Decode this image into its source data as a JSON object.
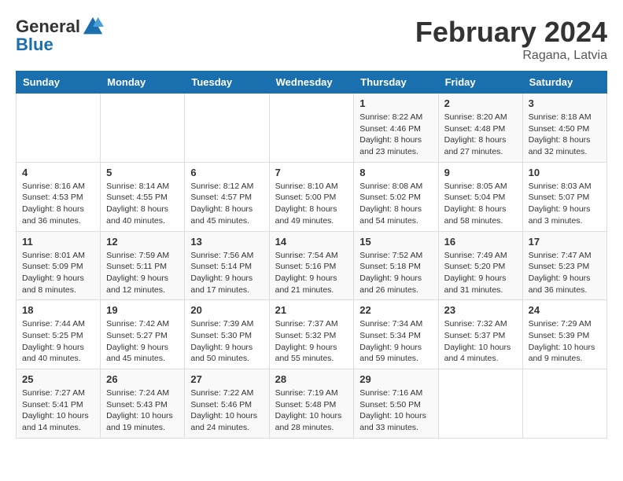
{
  "header": {
    "logo_general": "General",
    "logo_blue": "Blue",
    "month_year": "February 2024",
    "location": "Ragana, Latvia"
  },
  "weekdays": [
    "Sunday",
    "Monday",
    "Tuesday",
    "Wednesday",
    "Thursday",
    "Friday",
    "Saturday"
  ],
  "weeks": [
    [
      {
        "day": "",
        "info": ""
      },
      {
        "day": "",
        "info": ""
      },
      {
        "day": "",
        "info": ""
      },
      {
        "day": "",
        "info": ""
      },
      {
        "day": "1",
        "info": "Sunrise: 8:22 AM\nSunset: 4:46 PM\nDaylight: 8 hours\nand 23 minutes."
      },
      {
        "day": "2",
        "info": "Sunrise: 8:20 AM\nSunset: 4:48 PM\nDaylight: 8 hours\nand 27 minutes."
      },
      {
        "day": "3",
        "info": "Sunrise: 8:18 AM\nSunset: 4:50 PM\nDaylight: 8 hours\nand 32 minutes."
      }
    ],
    [
      {
        "day": "4",
        "info": "Sunrise: 8:16 AM\nSunset: 4:53 PM\nDaylight: 8 hours\nand 36 minutes."
      },
      {
        "day": "5",
        "info": "Sunrise: 8:14 AM\nSunset: 4:55 PM\nDaylight: 8 hours\nand 40 minutes."
      },
      {
        "day": "6",
        "info": "Sunrise: 8:12 AM\nSunset: 4:57 PM\nDaylight: 8 hours\nand 45 minutes."
      },
      {
        "day": "7",
        "info": "Sunrise: 8:10 AM\nSunset: 5:00 PM\nDaylight: 8 hours\nand 49 minutes."
      },
      {
        "day": "8",
        "info": "Sunrise: 8:08 AM\nSunset: 5:02 PM\nDaylight: 8 hours\nand 54 minutes."
      },
      {
        "day": "9",
        "info": "Sunrise: 8:05 AM\nSunset: 5:04 PM\nDaylight: 8 hours\nand 58 minutes."
      },
      {
        "day": "10",
        "info": "Sunrise: 8:03 AM\nSunset: 5:07 PM\nDaylight: 9 hours\nand 3 minutes."
      }
    ],
    [
      {
        "day": "11",
        "info": "Sunrise: 8:01 AM\nSunset: 5:09 PM\nDaylight: 9 hours\nand 8 minutes."
      },
      {
        "day": "12",
        "info": "Sunrise: 7:59 AM\nSunset: 5:11 PM\nDaylight: 9 hours\nand 12 minutes."
      },
      {
        "day": "13",
        "info": "Sunrise: 7:56 AM\nSunset: 5:14 PM\nDaylight: 9 hours\nand 17 minutes."
      },
      {
        "day": "14",
        "info": "Sunrise: 7:54 AM\nSunset: 5:16 PM\nDaylight: 9 hours\nand 21 minutes."
      },
      {
        "day": "15",
        "info": "Sunrise: 7:52 AM\nSunset: 5:18 PM\nDaylight: 9 hours\nand 26 minutes."
      },
      {
        "day": "16",
        "info": "Sunrise: 7:49 AM\nSunset: 5:20 PM\nDaylight: 9 hours\nand 31 minutes."
      },
      {
        "day": "17",
        "info": "Sunrise: 7:47 AM\nSunset: 5:23 PM\nDaylight: 9 hours\nand 36 minutes."
      }
    ],
    [
      {
        "day": "18",
        "info": "Sunrise: 7:44 AM\nSunset: 5:25 PM\nDaylight: 9 hours\nand 40 minutes."
      },
      {
        "day": "19",
        "info": "Sunrise: 7:42 AM\nSunset: 5:27 PM\nDaylight: 9 hours\nand 45 minutes."
      },
      {
        "day": "20",
        "info": "Sunrise: 7:39 AM\nSunset: 5:30 PM\nDaylight: 9 hours\nand 50 minutes."
      },
      {
        "day": "21",
        "info": "Sunrise: 7:37 AM\nSunset: 5:32 PM\nDaylight: 9 hours\nand 55 minutes."
      },
      {
        "day": "22",
        "info": "Sunrise: 7:34 AM\nSunset: 5:34 PM\nDaylight: 9 hours\nand 59 minutes."
      },
      {
        "day": "23",
        "info": "Sunrise: 7:32 AM\nSunset: 5:37 PM\nDaylight: 10 hours\nand 4 minutes."
      },
      {
        "day": "24",
        "info": "Sunrise: 7:29 AM\nSunset: 5:39 PM\nDaylight: 10 hours\nand 9 minutes."
      }
    ],
    [
      {
        "day": "25",
        "info": "Sunrise: 7:27 AM\nSunset: 5:41 PM\nDaylight: 10 hours\nand 14 minutes."
      },
      {
        "day": "26",
        "info": "Sunrise: 7:24 AM\nSunset: 5:43 PM\nDaylight: 10 hours\nand 19 minutes."
      },
      {
        "day": "27",
        "info": "Sunrise: 7:22 AM\nSunset: 5:46 PM\nDaylight: 10 hours\nand 24 minutes."
      },
      {
        "day": "28",
        "info": "Sunrise: 7:19 AM\nSunset: 5:48 PM\nDaylight: 10 hours\nand 28 minutes."
      },
      {
        "day": "29",
        "info": "Sunrise: 7:16 AM\nSunset: 5:50 PM\nDaylight: 10 hours\nand 33 minutes."
      },
      {
        "day": "",
        "info": ""
      },
      {
        "day": "",
        "info": ""
      }
    ]
  ]
}
